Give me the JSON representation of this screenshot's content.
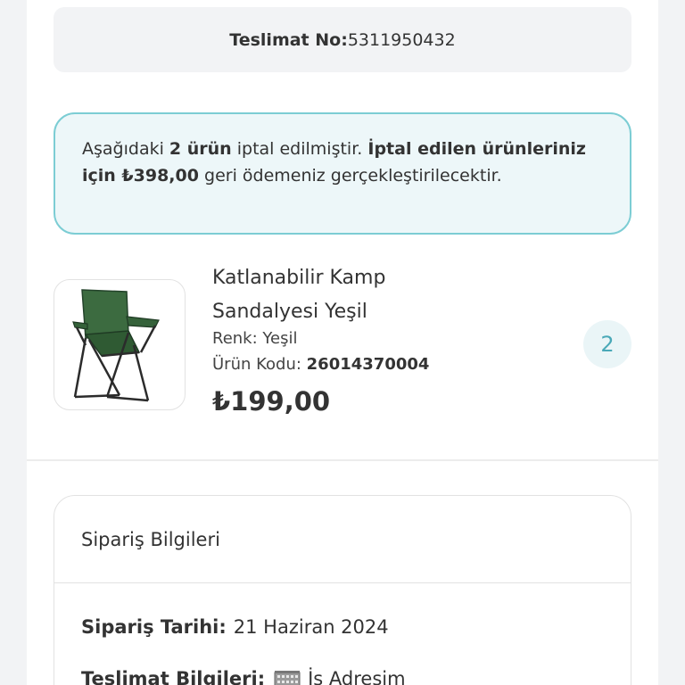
{
  "delivery": {
    "label": "Teslimat No:",
    "number": "5311950432"
  },
  "cancel_notice": {
    "part1": "Aşağıdaki ",
    "count_bold": "2 ürün",
    "part2": " iptal edilmiştir. ",
    "bold_refund": "İptal edilen ürünleriniz için ₺398,00",
    "part3": " geri ödemeniz gerçekleştirilecektir."
  },
  "product": {
    "name": "Katlanabilir Kamp Sandalyesi Yeşil",
    "color_label": "Renk: ",
    "color_value": "Yeşil",
    "code_label": "Ürün Kodu: ",
    "code_value": "26014370004",
    "price": "₺199,00",
    "quantity": "2",
    "image_icon": "camping-chair"
  },
  "order_info": {
    "title": "Sipariş Bilgileri",
    "date_label": "Sipariş Tarihi:",
    "date_value": "21 Haziran 2024",
    "delivery_label": "Teslimat Bilgileri:",
    "delivery_icon": "building-icon",
    "delivery_value": "İş Adresim"
  },
  "colors": {
    "accent": "#4aa9b8",
    "notice_border": "#7ccdd4",
    "notice_bg": "#edf7f9",
    "chair_green": "#2f5a33"
  }
}
